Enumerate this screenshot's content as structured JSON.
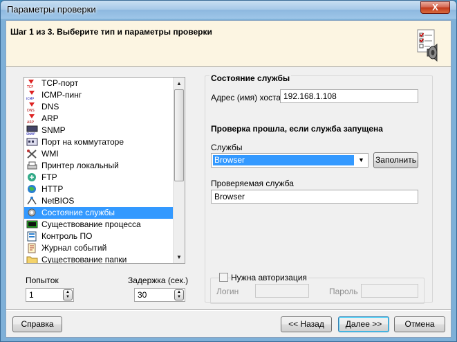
{
  "window": {
    "title": "Параметры проверки",
    "close_glyph": "X"
  },
  "header": {
    "text": "Шаг 1 из 3. Выберите тип и параметры проверки",
    "icon": "checklist-speaker-icon"
  },
  "check_types": [
    {
      "label": "TCP-порт",
      "icon": "tcp-icon"
    },
    {
      "label": "ICMP-пинг",
      "icon": "icmp-icon"
    },
    {
      "label": "DNS",
      "icon": "dns-icon"
    },
    {
      "label": "ARP",
      "icon": "arp-icon"
    },
    {
      "label": "SNMP",
      "icon": "snmp-icon"
    },
    {
      "label": "Порт на коммутаторе",
      "icon": "switch-port-icon"
    },
    {
      "label": "WMI",
      "icon": "wmi-icon"
    },
    {
      "label": "Принтер локальный",
      "icon": "printer-icon"
    },
    {
      "label": "FTP",
      "icon": "ftp-icon"
    },
    {
      "label": "HTTP",
      "icon": "http-icon"
    },
    {
      "label": "NetBIOS",
      "icon": "netbios-icon"
    },
    {
      "label": "Состояние службы",
      "icon": "service-icon",
      "selected": true
    },
    {
      "label": "Существование процесса",
      "icon": "process-icon"
    },
    {
      "label": "Контроль ПО",
      "icon": "software-icon"
    },
    {
      "label": "Журнал событий",
      "icon": "eventlog-icon"
    },
    {
      "label": "Существование папки",
      "icon": "folder-icon"
    }
  ],
  "retries": {
    "label": "Попыток",
    "value": "1"
  },
  "delay": {
    "label": "Задержка (сек.)",
    "value": "30"
  },
  "service_panel": {
    "title": "Состояние службы",
    "host_label": "Адрес (имя) хоста",
    "host_value": "192.168.1.108",
    "condition_title": "Проверка прошла, если служба запущена",
    "services_label": "Службы",
    "services_selected": "Browser",
    "fill_button": "Заполнить",
    "checked_service_label": "Проверяемая служба",
    "checked_service_value": "Browser"
  },
  "auth": {
    "checkbox_label": "Нужна авторизация",
    "checked": false,
    "login_label": "Логин",
    "login_value": "",
    "password_label": "Пароль",
    "password_value": ""
  },
  "footer": {
    "help": "Справка",
    "back": "<< Назад",
    "next": "Далее >>",
    "cancel": "Отмена"
  }
}
